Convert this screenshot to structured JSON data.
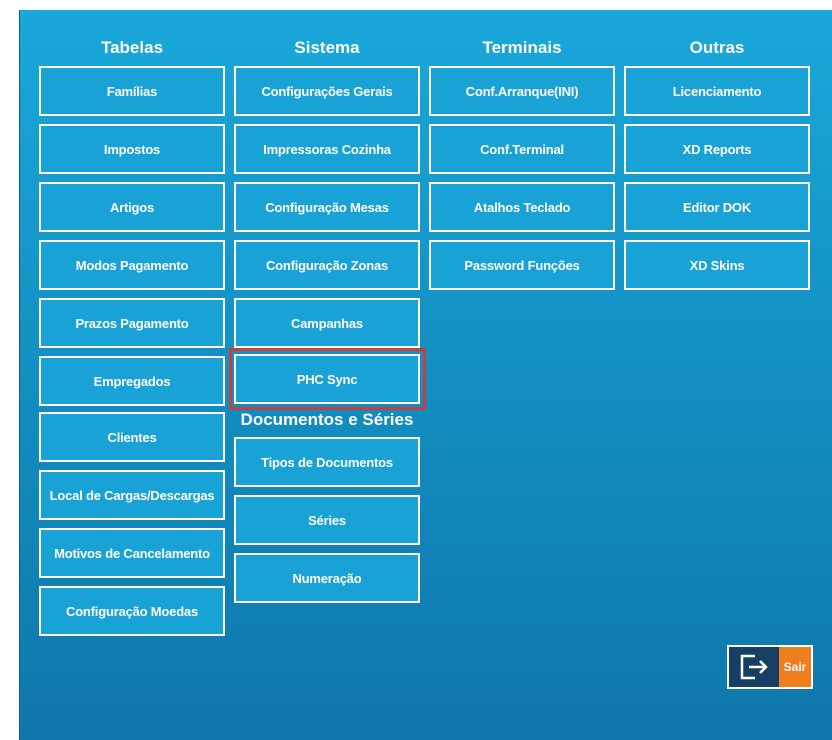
{
  "columns": {
    "tabelas": {
      "title": "Tabelas",
      "items": [
        "Famílias",
        "Impostos",
        "Artigos",
        "Modos Pagamento",
        "Prazos Pagamento",
        "Empregados",
        "Clientes",
        "Local de Cargas/Descargas",
        "Motivos de Cancelamento",
        "Configuração Moedas"
      ]
    },
    "sistema": {
      "title": "Sistema",
      "items": [
        "Configurações Gerais",
        "Impressoras Cozinha",
        "Configuração Mesas",
        "Configuração Zonas",
        "Campanhas",
        "PHC Sync"
      ]
    },
    "terminais": {
      "title": "Terminais",
      "items": [
        "Conf.Arranque(INI)",
        "Conf.Terminal",
        "Atalhos Teclado",
        "Password Funções"
      ]
    },
    "outras": {
      "title": "Outras",
      "items": [
        "Licenciamento",
        "XD Reports",
        "Editor DOK",
        "XD Skins"
      ]
    }
  },
  "documentos": {
    "title": "Documentos e Séries",
    "items": [
      "Tipos de Documentos",
      "Séries",
      "Numeração"
    ]
  },
  "exit": {
    "label": "Sair",
    "icon": "exit-icon"
  },
  "colors": {
    "panel": "#1aa8da",
    "button": "#19a2d6",
    "highlight": "#c4413b",
    "exit_icon_bg": "#173f63",
    "exit_label_bg": "#ee7f1f"
  }
}
